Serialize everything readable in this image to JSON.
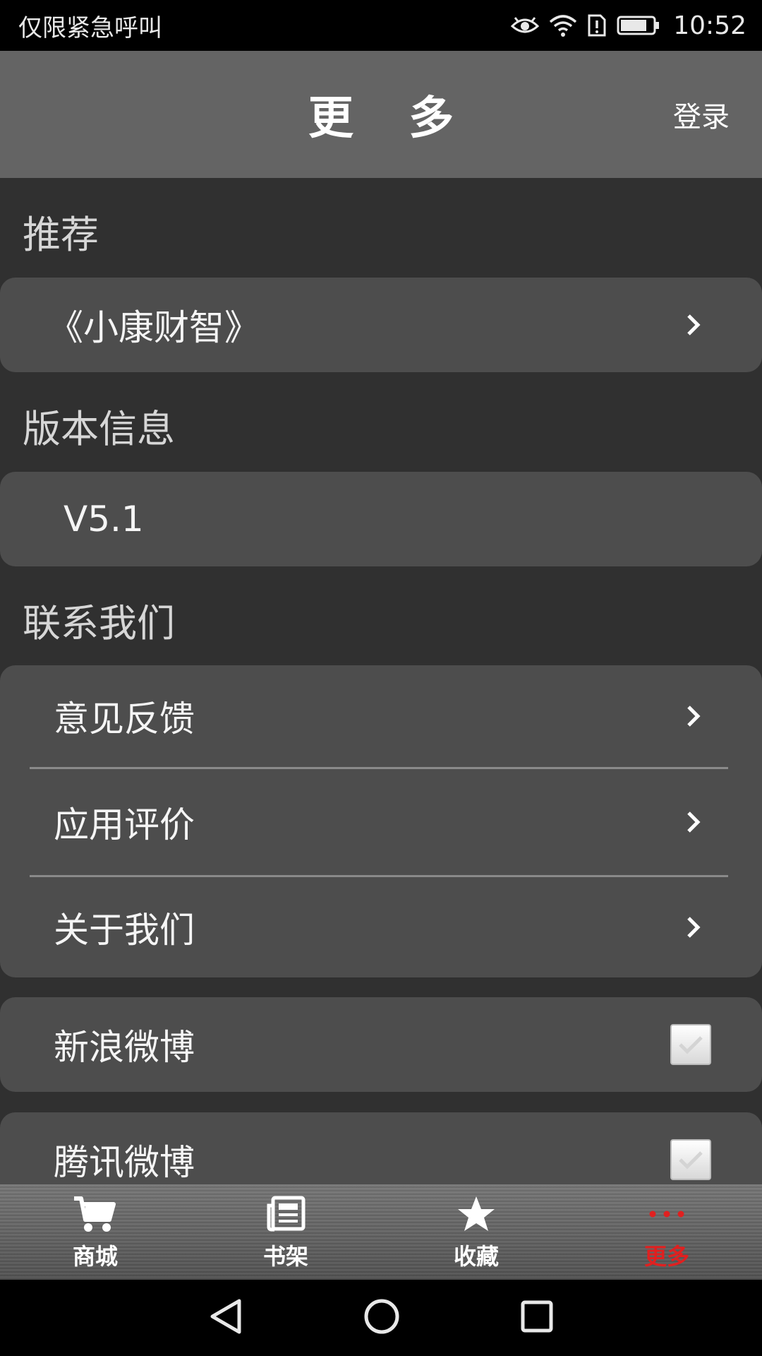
{
  "status_bar": {
    "carrier_text": "仅限紧急呼叫",
    "time": "10:52"
  },
  "header": {
    "title": "更 多",
    "login_label": "登录"
  },
  "sections": {
    "recommend": {
      "title": "推荐",
      "items": [
        {
          "label": "《小康财智》"
        }
      ]
    },
    "version": {
      "title": "版本信息",
      "value": "V5.1"
    },
    "contact": {
      "title": "联系我们",
      "items": [
        {
          "label": "意见反馈"
        },
        {
          "label": "应用评价"
        },
        {
          "label": "关于我们"
        }
      ]
    },
    "share": {
      "items": [
        {
          "label": "新浪微博",
          "checked": true
        },
        {
          "label": "腾讯微博",
          "checked": true
        }
      ]
    }
  },
  "bottom_nav": {
    "items": [
      {
        "label": "商城",
        "icon": "cart-icon",
        "active": false
      },
      {
        "label": "书架",
        "icon": "newspaper-icon",
        "active": false
      },
      {
        "label": "收藏",
        "icon": "star-icon",
        "active": false
      },
      {
        "label": "更多",
        "icon": "more-dots-icon",
        "active": true
      }
    ],
    "active_color": "#e02020"
  },
  "colors": {
    "background": "#303030",
    "card": "#4d4d4d",
    "title_bar": "#646464"
  }
}
